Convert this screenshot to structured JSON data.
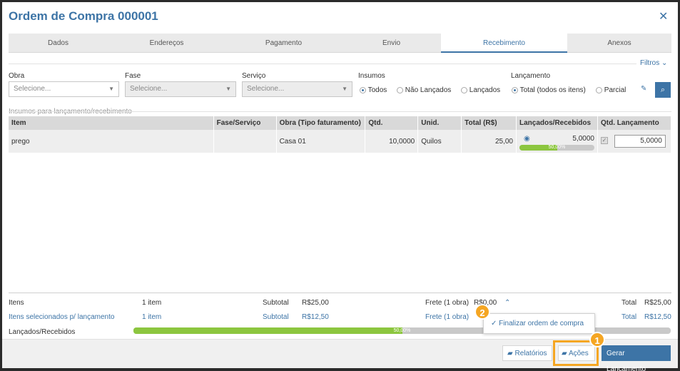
{
  "dialog": {
    "title": "Ordem de Compra 000001",
    "close_icon": "close-icon"
  },
  "tabs": [
    {
      "label": "Dados"
    },
    {
      "label": "Endereços"
    },
    {
      "label": "Pagamento"
    },
    {
      "label": "Envio"
    },
    {
      "label": "Recebimento",
      "active": true
    },
    {
      "label": "Anexos"
    }
  ],
  "filters": {
    "toggle_label": "Filtros",
    "obra": {
      "label": "Obra",
      "placeholder": "Selecione..."
    },
    "fase": {
      "label": "Fase",
      "placeholder": "Selecione..."
    },
    "servico": {
      "label": "Serviço",
      "placeholder": "Selecione..."
    },
    "insumos": {
      "label": "Insumos",
      "options": [
        "Todos",
        "Não Lançados",
        "Lançados"
      ],
      "selected": "Todos"
    },
    "lancamento": {
      "label": "Lançamento",
      "options": [
        "Total (todos os itens)",
        "Parcial"
      ],
      "selected": "Total (todos os itens)"
    }
  },
  "section_title": "Insumos para lançamento/recebimento",
  "table": {
    "headers": [
      "Item",
      "Fase/Serviço",
      "Obra (Tipo faturamento)",
      "Qtd.",
      "Unid.",
      "Total (R$)",
      "Lançados/Recebidos",
      "Qtd. Lançamento"
    ],
    "rows": [
      {
        "item": "prego",
        "fase": "",
        "obra": "Casa 01",
        "qtd": "10,0000",
        "unid": "Quilos",
        "total": "25,00",
        "lancados": "5,0000",
        "progress": 0.5,
        "progress_label": "50,00%",
        "qtd_lancamento": "5,0000"
      }
    ]
  },
  "summary": {
    "itens_label": "Itens",
    "itens_value": "1 item",
    "subtotal_label": "Subtotal",
    "subtotal_value": "R$25,00",
    "frete_label": "Frete (1 obra)",
    "frete_value": "R$0,00",
    "total_label": "Total",
    "total_value": "R$25,00",
    "sel_label": "Itens selecionados p/ lançamento",
    "sel_itens": "1 item",
    "sel_subtotal_label": "Subtotal",
    "sel_subtotal": "R$12,50",
    "sel_frete_label": "Frete (1 obra)",
    "sel_total_label": "Total",
    "sel_total": "R$12,50",
    "lancados_label": "Lançados/Recebidos",
    "progress": 0.5,
    "progress_label": "50,00%"
  },
  "actions_menu": {
    "items": [
      "Finalizar ordem de compra"
    ]
  },
  "footer": {
    "relatorios": "Relatórios",
    "acoes": "Ações",
    "gerar": "Gerar Lançamento"
  },
  "annotations": {
    "badge1": "1",
    "badge2": "2"
  },
  "colors": {
    "primary": "#3d74a6",
    "progress": "#8cc63f",
    "highlight": "#f5a623"
  }
}
